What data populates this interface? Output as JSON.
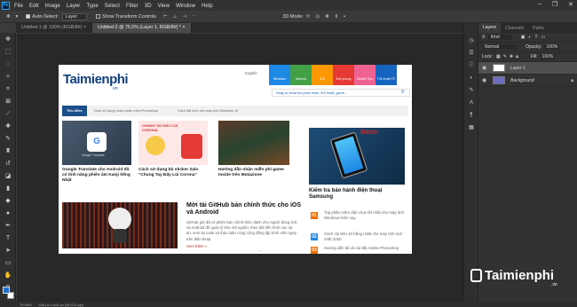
{
  "menubar": {
    "items": [
      "File",
      "Edit",
      "Image",
      "Layer",
      "Type",
      "Select",
      "Filter",
      "3D",
      "View",
      "Window",
      "Help"
    ],
    "logo": "Ps",
    "controls": [
      "–",
      "❐",
      "✕"
    ]
  },
  "options": {
    "auto_select": "Auto-Select:",
    "auto_select_value": "Layer",
    "show_transform": "Show Transform Controls",
    "mode_3d": "3D Mode:"
  },
  "tabs": [
    "Untitled-1 @ 100% (RGB/8#) ×",
    "Untitled-2 @ 75.5% (Layer 1, RGB/8#) * ×"
  ],
  "status": {
    "zoom": "75.48%",
    "size": "548 px x 644 px (96.012 ppi)"
  },
  "panel": {
    "tabs": [
      "Layers",
      "Channels",
      "Paths"
    ],
    "kind": "Kind",
    "blend": "Normal",
    "opacity_label": "Opacity:",
    "opacity": "100%",
    "lock_label": "Lock:",
    "fill_label": "Fill:",
    "fill": "100%",
    "layers": [
      {
        "name": "Layer 1"
      },
      {
        "name": "Background"
      }
    ]
  },
  "website": {
    "logo": "Taimienphi",
    "logo_suffix": ".vn",
    "lang": "English",
    "categories": [
      {
        "label": "Windows",
        "color": "#1e88e5"
      },
      {
        "label": "Android",
        "color": "#43a047"
      },
      {
        "label": "iOS",
        "color": "#ff9800"
      },
      {
        "label": "Ảnh phong",
        "color": "#e53935"
      },
      {
        "label": "Mobile Tips",
        "color": "#f06292"
      },
      {
        "label": "Thủ thuật PC",
        "color": "#1565c0"
      }
    ],
    "search_placeholder": "Nhập từ khóa tìm phần mềm, thủ thuật, game...",
    "trend_label": "Tiêu điểm",
    "trend_items": [
      "Cách sử dụng nhiều phần mềm Photoshop",
      "Cách đổi hình nền máy tính Windows 10"
    ],
    "cards": [
      {
        "caption": "Google Translate cho Android đã có tính năng phiên âm Kanji tiếng Nhật",
        "tile": "Google Translate"
      },
      {
        "caption": "Cách sử dụng bộ sticker Zalo \"Chung Tay Đẩy Lùi Corona\"",
        "banner": "CHUNG TAY ĐẨY LÙI CORONA"
      },
      {
        "caption": "Hướng dẫn nhận miễn phí game Inside trên Mutazione"
      }
    ],
    "feature": {
      "title": "Mời tải GitHub bản chính thức cho iOS và Android",
      "excerpt": "GitHub giờ đã có phiên bản chính thức dành cho người dùng iOS và Android để quản lý kho mã nguồn, theo dõi tiến trình các dự án, xem lại code và thảo luận cùng cộng đồng lập trình viên ngay trên điện thoại.",
      "more": "Xem thêm »"
    },
    "side_main": {
      "title": "Kiểm tra báo hành điện thoại Samsung",
      "brand": "9Mobi"
    },
    "news": [
      {
        "num": "01",
        "text": "Top phần mềm diệt virus tốt nhất cho máy tính Windows hiện nay"
      },
      {
        "num": "02",
        "text": "Cách cài Win 10 bằng USB cho máy tính mới nhất 2020"
      },
      {
        "num": "03",
        "text": "Hướng dẫn tải và cài đặt Adobe Photoshop"
      }
    ],
    "dots": "..."
  },
  "watermark": {
    "brand": "Taimienphi",
    "suffix": ".vn"
  }
}
